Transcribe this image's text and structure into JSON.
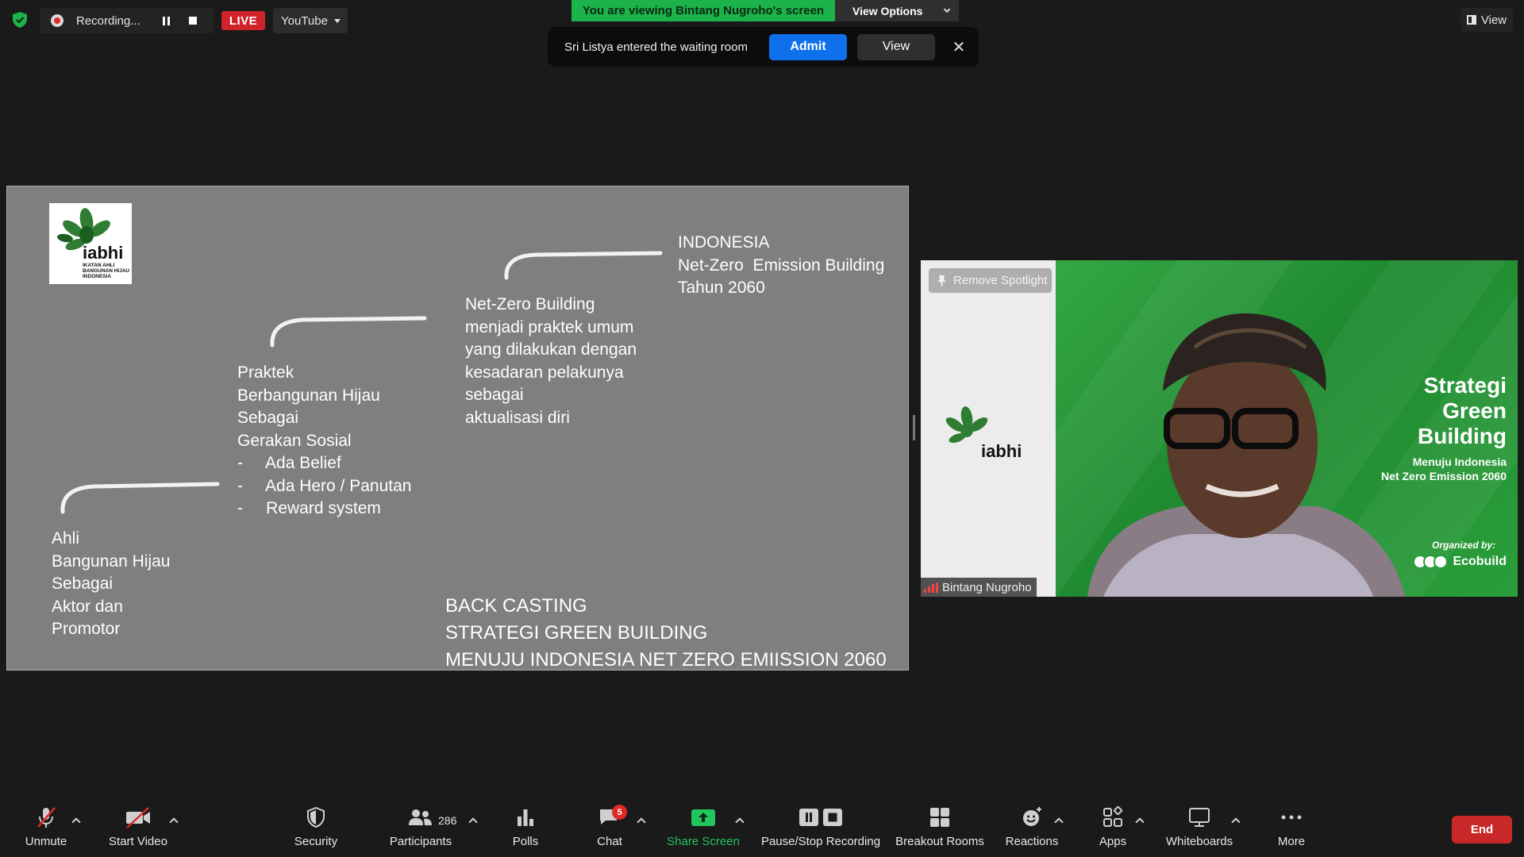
{
  "top_bar": {
    "recording_label": "Recording...",
    "live_label": "LIVE",
    "stream_target": "YouTube",
    "viewing_banner": "You are viewing Bintang Nugroho's screen",
    "view_options_label": "View Options",
    "view_label": "View"
  },
  "waiting_room_toast": {
    "message": "Sri Listya entered the waiting room",
    "admit_label": "Admit",
    "view_label": "View",
    "close_glyph": "✕"
  },
  "slide": {
    "logo_text_main": "iabhi",
    "logo_text_sub": [
      "IKATAN AHLI",
      "BANGUNAN HIJAU",
      "INDONESIA"
    ],
    "block_ahli": "Ahli\nBangunan Hijau\nSebagai\nAktor dan\nPromotor",
    "block_praktek": "Praktek\nBerbangunan Hijau\nSebagai\nGerakan Sosial\n-     Ada Belief\n-     Ada Hero / Panutan\n-     Reward system",
    "block_netzero": "Net-Zero Building\nmenjadi praktek umum\nyang dilakukan dengan\nkesadaran pelakunya\nsebagai\naktualisasi diri",
    "block_indonesia": "INDONESIA\nNet-Zero  Emission Building\nTahun 2060",
    "bottom_title": "BACK CASTING\nSTRATEGI GREEN BUILDING\nMENUJU INDONESIA NET ZERO EMIISSION 2060"
  },
  "video": {
    "remove_spotlight_label": "Remove Spotlight",
    "logo_text": "iabhi",
    "title_lines": [
      "Strategi",
      "Green",
      "Building"
    ],
    "subtitle_lines": [
      "Menuju Indonesia",
      "Net Zero Emission 2060"
    ],
    "organized_by": "Organized by:",
    "organizer": "Ecobuild",
    "speaker_name": "Bintang Nugroho"
  },
  "toolbar": {
    "unmute_label": "Unmute",
    "start_video_label": "Start Video",
    "security_label": "Security",
    "participants_label": "Participants",
    "participants_count": "286",
    "polls_label": "Polls",
    "chat_label": "Chat",
    "chat_badge": "5",
    "share_screen_label": "Share Screen",
    "pause_stop_label": "Pause/Stop Recording",
    "breakout_label": "Breakout Rooms",
    "reactions_label": "Reactions",
    "apps_label": "Apps",
    "whiteboards_label": "Whiteboards",
    "more_label": "More",
    "end_label": "End"
  },
  "colors": {
    "share_green": "#22c55e",
    "admit_blue": "#0e71eb",
    "end_red": "#c92828",
    "live_red": "#d0242b",
    "banner_green": "#1cb34b"
  }
}
